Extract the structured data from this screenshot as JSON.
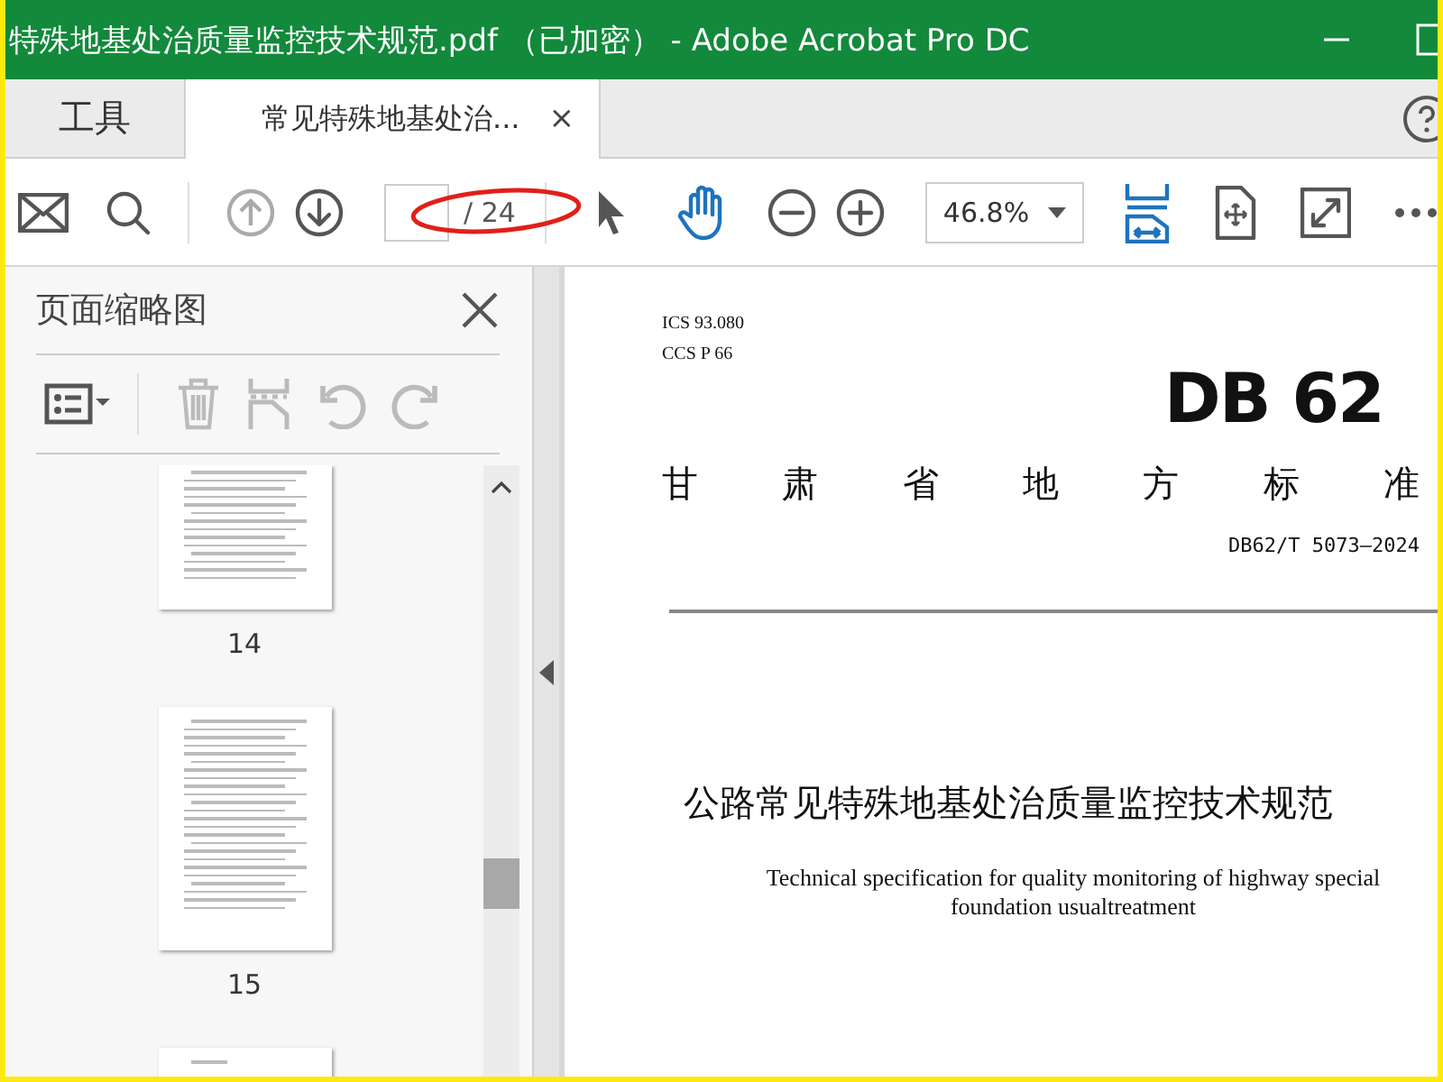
{
  "window": {
    "title": "特殊地基处治质量监控技术规范.pdf （已加密） - Adobe Acrobat Pro DC"
  },
  "tabs": [
    {
      "label": "工具",
      "selected": false
    },
    {
      "label": "常见特殊地基处治...",
      "selected": true,
      "close": "×"
    }
  ],
  "toolbar": {
    "page_total": "/ 24",
    "zoom": "46.8%"
  },
  "sidebar": {
    "title": "页面缩略图",
    "thumbnails": [
      {
        "label": "14"
      },
      {
        "label": "15"
      }
    ]
  },
  "document": {
    "ics": "ICS 93.080",
    "ccs": "CCS P 66",
    "logo": "DB 62",
    "issuer_chars": [
      "甘",
      "肃",
      "省",
      "地",
      "方",
      "标",
      "准"
    ],
    "code": "DB62/T 5073—2024",
    "title": "公路常见特殊地基处治质量监控技术规范",
    "subtitle": "Technical specification for quality monitoring of highway special foundation usualtreatment"
  }
}
